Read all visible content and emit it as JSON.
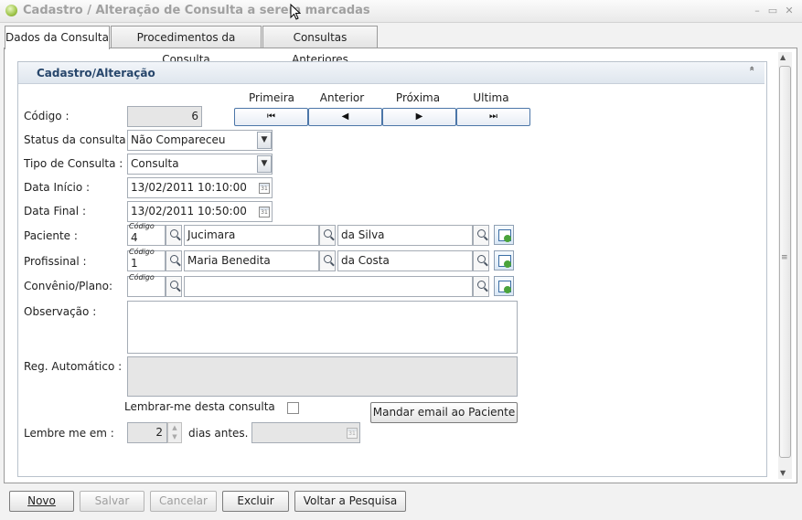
{
  "window": {
    "title": "Cadastro / Alteração de Consulta a serem marcadas",
    "minimize": "▭",
    "maximize": "▭",
    "close": "✕"
  },
  "tabs": [
    {
      "label": "Dados da Consulta"
    },
    {
      "label": "Procedimentos da Consulta"
    },
    {
      "label": "Consultas Anteriores"
    }
  ],
  "panel": {
    "title": "Cadastro/Alteração"
  },
  "nav": {
    "first": "Primeira",
    "prev": "Anterior",
    "next": "Próxima",
    "last": "Ultima",
    "first_glyph": "⏮",
    "prev_glyph": "◀",
    "next_glyph": "▶",
    "last_glyph": "⏭"
  },
  "form": {
    "codigo": {
      "label": "Código :",
      "value": "6"
    },
    "status": {
      "label": "Status da consulta:",
      "value": "Não Compareceu"
    },
    "tipo": {
      "label": "Tipo de Consulta :",
      "value": "Consulta"
    },
    "data_inicio": {
      "label": "Data Início :",
      "value": "13/02/2011 10:10:00"
    },
    "data_final": {
      "label": "Data Final :",
      "value": "13/02/2011 10:50:00"
    },
    "paciente": {
      "label": "Paciente :",
      "code_caption": "Código",
      "code": "4",
      "name": "Jucimara",
      "surname": "da Silva"
    },
    "profissional": {
      "label": "Profissinal :",
      "code_caption": "Código",
      "code": "1",
      "name": "Maria Benedita",
      "surname": "da Costa"
    },
    "convenio": {
      "label": "Convênio/Plano:",
      "code_caption": "Código",
      "code": "",
      "name": ""
    },
    "observacao": {
      "label": "Observação :",
      "value": ""
    },
    "reg_automatico": {
      "label": "Reg. Automático :",
      "value": ""
    },
    "lembrar": {
      "label": "Lembrar-me desta consulta",
      "checked": false
    },
    "email_button": "Mandar email ao Paciente",
    "lembre_me_em": {
      "label": "Lembre me em :",
      "value": "2",
      "suffix": "dias antes."
    }
  },
  "footer": {
    "novo": "Novo",
    "salvar": "Salvar",
    "cancelar": "Cancelar",
    "excluir": "Excluir",
    "voltar": "Voltar a Pesquisa"
  },
  "colors": {
    "accent": "#27466b",
    "nav_border": "#4c76a8"
  }
}
